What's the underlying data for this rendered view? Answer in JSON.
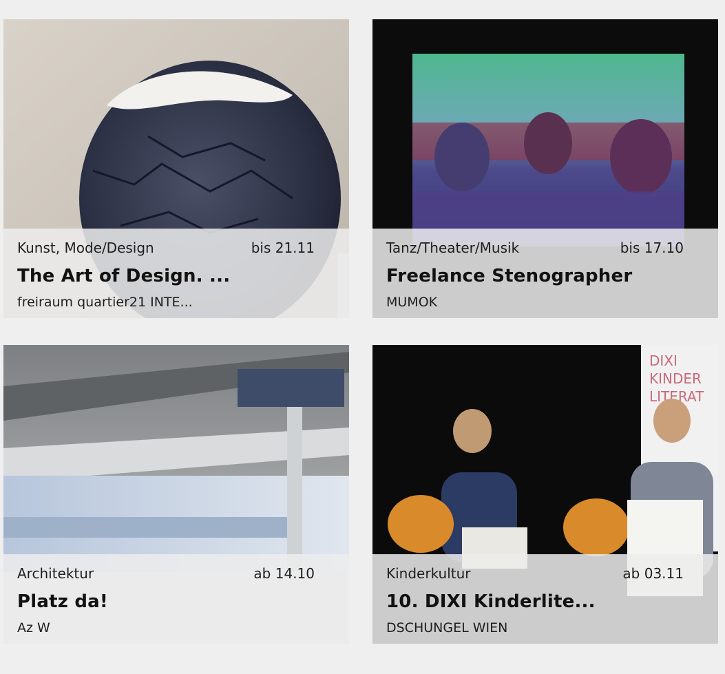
{
  "cards": [
    {
      "category": "Kunst, Mode/Design",
      "date": "bis 21.11",
      "title": "The Art of Design. ...",
      "venue": "freiraum quartier21 INTE..."
    },
    {
      "category": "Tanz/Theater/Musik",
      "date": "bis 17.10",
      "title": "Freelance Stenographer",
      "venue": "MUMOK"
    },
    {
      "category": "Architektur",
      "date": "ab 14.10",
      "title": "Platz da!",
      "venue": "Az W"
    },
    {
      "category": "Kinderkultur",
      "date": "ab 03.11",
      "title": "10. DIXI Kinderlite...",
      "venue": "DSCHUNGEL WIEN",
      "poster_text": [
        "DIXI",
        "KINDER",
        "LITERAT"
      ]
    }
  ],
  "colors": {
    "page_background": "#efefef",
    "info_panel": "#ececec",
    "text": "#111111",
    "poster_pink": "#c86a7c"
  }
}
